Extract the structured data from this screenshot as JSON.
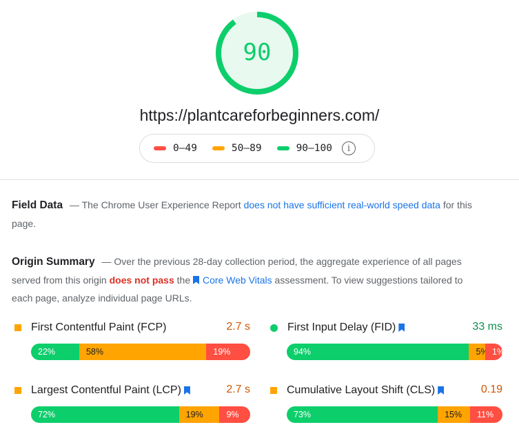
{
  "score": {
    "value": "90",
    "fraction": 0.9,
    "color": "#0cce6b"
  },
  "url": "https://plantcareforbeginners.com/",
  "legend": {
    "items": [
      {
        "label": "0–49",
        "color": "#ff4e42"
      },
      {
        "label": "50–89",
        "color": "#ffa400"
      },
      {
        "label": "90–100",
        "color": "#0cce6b"
      }
    ],
    "info_icon": "info-icon"
  },
  "field_data": {
    "title": "Field Data",
    "prefix": "— The Chrome User Experience Report",
    "link": "does not have sufficient real-world speed data",
    "suffix": "for this page."
  },
  "origin_summary": {
    "title": "Origin Summary",
    "text1": "— Over the previous 28-day collection period, the aggregate experience of all pages served from this origin",
    "fail": "does not pass",
    "text2": "the",
    "link": "Core Web Vitals",
    "text3": "assessment. To view suggestions tailored to each page, analyze individual page URLs."
  },
  "metrics": [
    {
      "name": "First Contentful Paint (FCP)",
      "value": "2.7 s",
      "value_color": "#d35400",
      "status": "average",
      "flag": false,
      "good": "22%",
      "avg": "58%",
      "poor": "19%",
      "good_frac": 0.22,
      "avg_frac": 0.58,
      "poor_frac": 0.2
    },
    {
      "name": "First Input Delay (FID)",
      "value": "33 ms",
      "value_color": "#0d904f",
      "status": "good",
      "flag": true,
      "good": "94%",
      "avg": "5%",
      "poor": "1%",
      "good_frac": 0.845,
      "avg_frac": 0.075,
      "poor_frac": 0.08
    },
    {
      "name": "Largest Contentful Paint (LCP)",
      "value": "2.7 s",
      "value_color": "#d35400",
      "status": "average",
      "flag": true,
      "good": "72%",
      "avg": "19%",
      "poor": "9%",
      "good_frac": 0.675,
      "avg_frac": 0.185,
      "poor_frac": 0.14
    },
    {
      "name": "Cumulative Layout Shift (CLS)",
      "value": "0.19",
      "value_color": "#d35400",
      "status": "average",
      "flag": true,
      "good": "73%",
      "avg": "15%",
      "poor": "11%",
      "good_frac": 0.7,
      "avg_frac": 0.15,
      "poor_frac": 0.15
    }
  ]
}
